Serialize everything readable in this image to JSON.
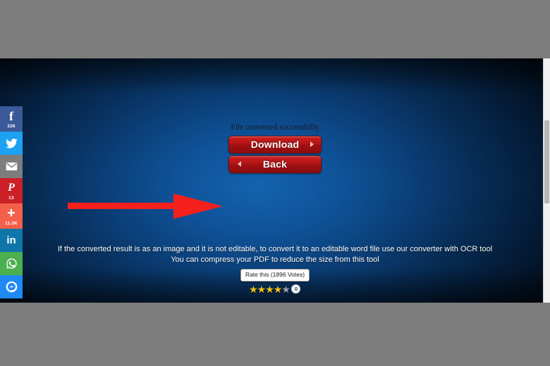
{
  "social_rail": [
    {
      "name": "facebook",
      "icon": "facebook-icon",
      "glyph": "f",
      "count": "326",
      "bg": "#3b5998"
    },
    {
      "name": "twitter",
      "icon": "twitter-icon",
      "glyph": "twitter",
      "count": "",
      "bg": "#1da1f2"
    },
    {
      "name": "email",
      "icon": "email-icon",
      "glyph": "envelope",
      "count": "",
      "bg": "#7d7d7d"
    },
    {
      "name": "pinterest",
      "icon": "pinterest-icon",
      "glyph": "P",
      "count": "13",
      "bg": "#cb2027"
    },
    {
      "name": "share-more",
      "icon": "plus-icon",
      "glyph": "+",
      "count": "11.3K",
      "bg": "#f4604a"
    },
    {
      "name": "linkedin",
      "icon": "linkedin-icon",
      "glyph": "in",
      "count": "",
      "bg": "#0e76a8"
    },
    {
      "name": "whatsapp",
      "icon": "whatsapp-icon",
      "glyph": "whatsapp",
      "count": "",
      "bg": "#4caf50"
    },
    {
      "name": "messenger",
      "icon": "messenger-icon",
      "glyph": "messenger",
      "count": "",
      "bg": "#1f8af5"
    }
  ],
  "main": {
    "status_text": "File converted successfully",
    "download_label": "Download",
    "back_label": "Back",
    "info_line_1": "If the converted result is as an image and it is not editable, to convert it to an editable word file use our converter with OCR tool",
    "info_line_2": "You can compress your PDF to reduce the size from this tool"
  },
  "rating": {
    "tooltip": "Rate this (1896 Votes)",
    "stars_filled": 4,
    "stars_total": 5,
    "badge_label": "0"
  },
  "colors": {
    "button_red": "#b81718",
    "arrow_red": "#f5201b",
    "page_blue": "#0f539a",
    "letterbox_gray": "#7c7c7c"
  },
  "annotation": {
    "arrow_icon": "arrow-right-pointer"
  }
}
